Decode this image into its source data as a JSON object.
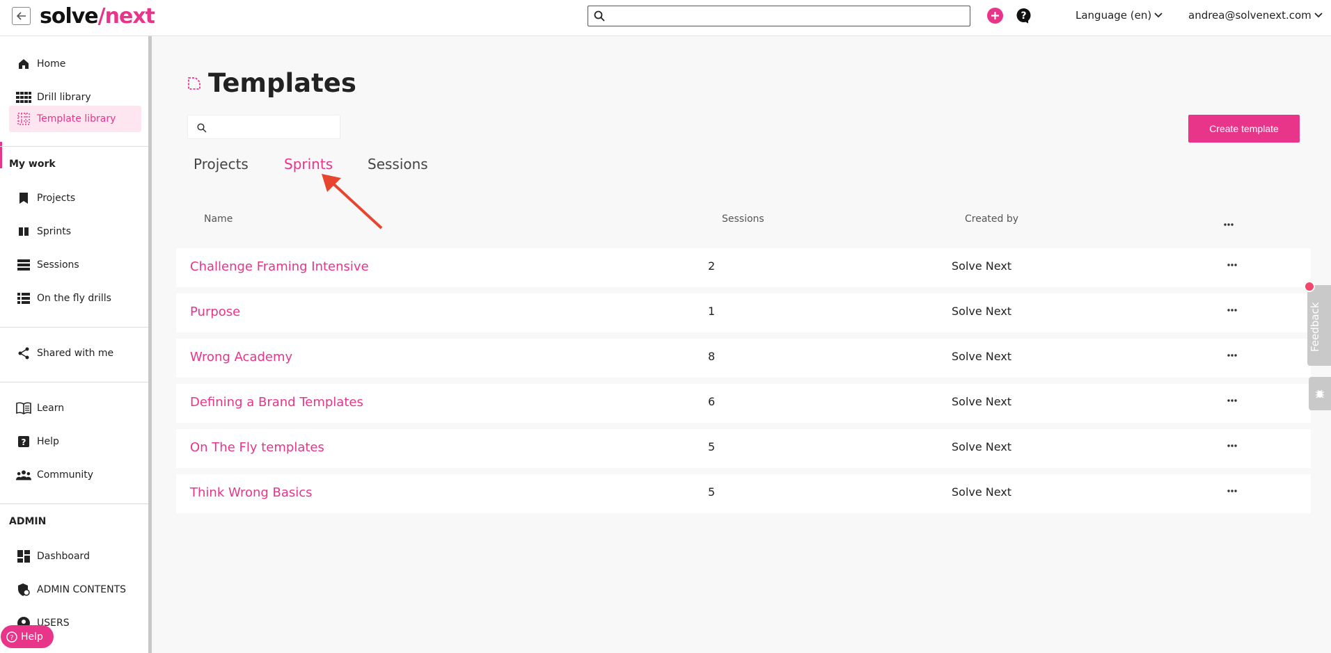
{
  "header": {
    "logo_part1": "solve",
    "logo_slash": "/",
    "logo_part2": "next",
    "search_placeholder": "",
    "language_label": "Language (en)",
    "user_email": "andrea@solvenext.com"
  },
  "sidebar": {
    "top_items": [
      {
        "label": "Home",
        "icon": "home-icon"
      },
      {
        "label": "Drill library",
        "icon": "grid-icon"
      },
      {
        "label": "Template library",
        "icon": "dotted-grid-icon",
        "active": true
      }
    ],
    "my_work_title": "My work",
    "my_work_items": [
      {
        "label": "Projects",
        "icon": "bookmark-icon"
      },
      {
        "label": "Sprints",
        "icon": "columns-icon"
      },
      {
        "label": "Sessions",
        "icon": "stack-icon"
      },
      {
        "label": "On the fly drills",
        "icon": "list-icon"
      }
    ],
    "shared": {
      "label": "Shared with me",
      "icon": "share-icon"
    },
    "resources": [
      {
        "label": "Learn",
        "icon": "book-icon"
      },
      {
        "label": "Help",
        "icon": "question-icon"
      },
      {
        "label": "Community",
        "icon": "people-icon"
      }
    ],
    "admin_title": "ADMIN",
    "admin_items": [
      {
        "label": "Dashboard",
        "icon": "dashboard-icon"
      },
      {
        "label": "ADMIN CONTENTS",
        "icon": "shield-icon"
      },
      {
        "label": "USERS",
        "icon": "user-icon"
      }
    ],
    "help_pill": "Help"
  },
  "main": {
    "title": "Templates",
    "search_placeholder": "",
    "create_button": "Create template",
    "tabs": [
      {
        "label": "Projects",
        "active": false
      },
      {
        "label": "Sprints",
        "active": true
      },
      {
        "label": "Sessions",
        "active": false
      }
    ],
    "columns": {
      "name": "Name",
      "sessions": "Sessions",
      "created_by": "Created by"
    },
    "rows": [
      {
        "name": "Challenge Framing Intensive",
        "sessions": "2",
        "created_by": "Solve Next"
      },
      {
        "name": "Purpose",
        "sessions": "1",
        "created_by": "Solve Next"
      },
      {
        "name": "Wrong Academy",
        "sessions": "8",
        "created_by": "Solve Next"
      },
      {
        "name": "Defining a Brand Templates",
        "sessions": "6",
        "created_by": "Solve Next"
      },
      {
        "name": "On The Fly templates",
        "sessions": "5",
        "created_by": "Solve Next"
      },
      {
        "name": "Think Wrong Basics",
        "sessions": "5",
        "created_by": "Solve Next"
      }
    ]
  },
  "feedback": {
    "label": "Feedback"
  },
  "colors": {
    "accent": "#e8358a",
    "arrow": "#e8452e"
  }
}
